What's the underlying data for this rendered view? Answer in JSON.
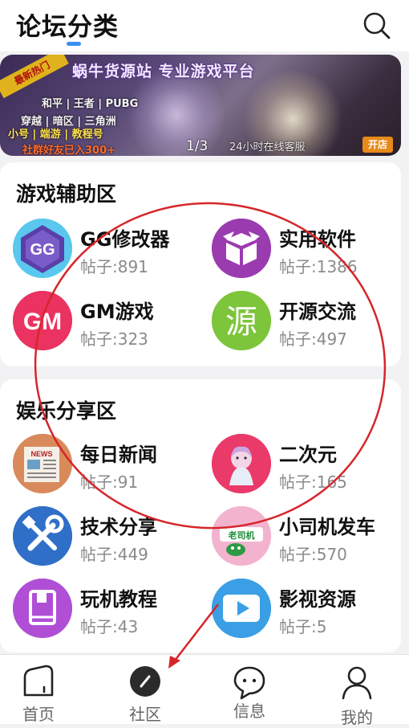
{
  "header": {
    "title": "论坛分类"
  },
  "banner": {
    "ribbon": "最新热门",
    "headline": "蜗牛货源站 专业游戏平台",
    "line1": "和平 | 王者 | PUBG",
    "line2": "穿越 | 暗区 | 三角洲",
    "line3": "小号 | 端游 | 教程号",
    "bottom": "社群好友已入300+",
    "counter": "1/3",
    "online": "24小时在线客服",
    "badge": "开店"
  },
  "sections": [
    {
      "title": "游戏辅助区",
      "items": [
        {
          "name": "GG修改器",
          "count": "帖子:891",
          "icon": "gg-modifier-icon"
        },
        {
          "name": "实用软件",
          "count": "帖子:1386",
          "icon": "box-icon"
        },
        {
          "name": "GM游戏",
          "count": "帖子:323",
          "icon": "gm-icon",
          "icon_text": "GM"
        },
        {
          "name": "开源交流",
          "count": "帖子:497",
          "icon": "source-icon",
          "icon_text": "源"
        }
      ]
    },
    {
      "title": "娱乐分享区",
      "items": [
        {
          "name": "每日新闻",
          "count": "帖子:91",
          "icon": "newspaper-icon",
          "icon_text": "NEWS"
        },
        {
          "name": "二次元",
          "count": "帖子:165",
          "icon": "anime-icon"
        },
        {
          "name": "技术分享",
          "count": "帖子:449",
          "icon": "tools-icon"
        },
        {
          "name": "小司机发车",
          "count": "帖子:570",
          "icon": "driver-icon",
          "icon_text": "老司机"
        },
        {
          "name": "玩机教程",
          "count": "帖子:43",
          "icon": "book-icon"
        },
        {
          "name": "影视资源",
          "count": "帖子:5",
          "icon": "play-icon"
        }
      ]
    }
  ],
  "tabs": [
    {
      "label": "首页",
      "icon": "home-icon"
    },
    {
      "label": "社区",
      "icon": "community-icon"
    },
    {
      "label": "信息",
      "icon": "message-icon"
    },
    {
      "label": "我的",
      "icon": "profile-icon"
    }
  ],
  "colors": {
    "accent": "#3a8ff0",
    "annotation": "#d6262b",
    "gm": "#ea3360",
    "source": "#7dc53a",
    "box": "#9b3bb0"
  }
}
